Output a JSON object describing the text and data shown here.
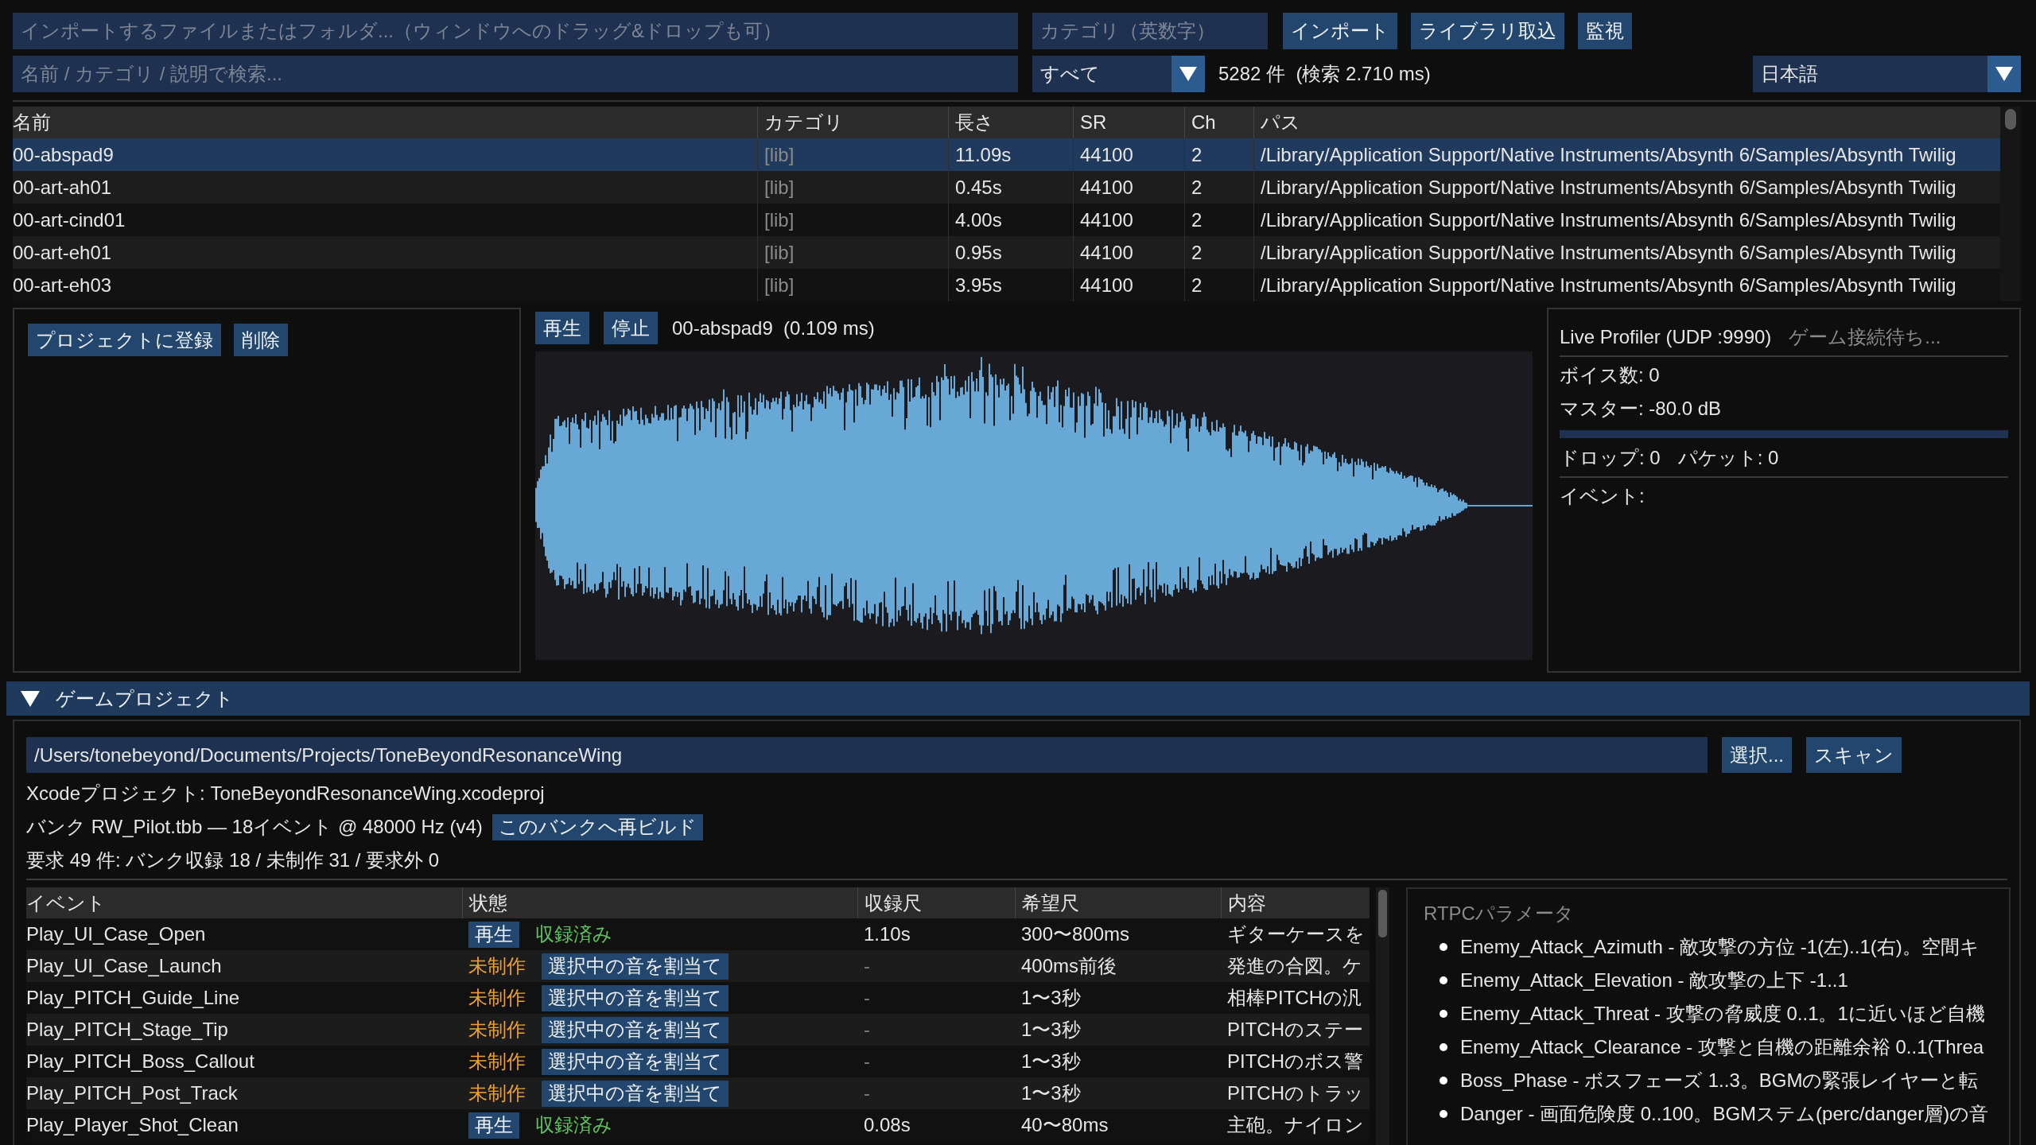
{
  "toolbar": {
    "import_field": {
      "placeholder": "インポートするファイルまたはフォルダ...（ウィンドウへのドラッグ&ドロップも可）"
    },
    "category_field": {
      "placeholder": "カテゴリ（英数字）"
    },
    "buttons": [
      "インポート",
      "ライブラリ取込",
      "監視"
    ],
    "search_field": {
      "placeholder": "名前 / カテゴリ / 説明で検索..."
    },
    "filter_dropdown": {
      "value": "すべて"
    },
    "result_count": "5282 件  (検索 2.710 ms)",
    "language_dropdown": {
      "value": "日本語"
    }
  },
  "library_table": {
    "columns": [
      "名前",
      "カテゴリ",
      "長さ",
      "SR",
      "Ch",
      "パス"
    ],
    "rows": [
      {
        "cells": [
          "00-abspad9",
          "[lib]",
          "11.09s",
          "44100",
          "2",
          "/Library/Application Support/Native Instruments/Absynth 6/Samples/Absynth Twilig"
        ],
        "selected": true
      },
      {
        "cells": [
          "00-art-ah01",
          "[lib]",
          "0.45s",
          "44100",
          "2",
          "/Library/Application Support/Native Instruments/Absynth 6/Samples/Absynth Twilig"
        ],
        "selected": false
      },
      {
        "cells": [
          "00-art-cind01",
          "[lib]",
          "4.00s",
          "44100",
          "2",
          "/Library/Application Support/Native Instruments/Absynth 6/Samples/Absynth Twilig"
        ],
        "selected": false
      },
      {
        "cells": [
          "00-art-eh01",
          "[lib]",
          "0.95s",
          "44100",
          "2",
          "/Library/Application Support/Native Instruments/Absynth 6/Samples/Absynth Twilig"
        ],
        "selected": false
      },
      {
        "cells": [
          "00-art-eh03",
          "[lib]",
          "3.95s",
          "44100",
          "2",
          "/Library/Application Support/Native Instruments/Absynth 6/Samples/Absynth Twilig"
        ],
        "selected": false
      }
    ]
  },
  "preview": {
    "side_buttons": [
      "プロジェクトに登録",
      "削除"
    ],
    "player_buttons": [
      "再生",
      "停止"
    ],
    "now_playing": "00-abspad9  (0.109 ms)"
  },
  "profiler": {
    "title": "Live Profiler (UDP :9990)",
    "status": "ゲーム接続待ち...",
    "voices": "ボイス数: 0",
    "master": "マスター: -80.0 dB",
    "master_meter": {
      "level": 0
    },
    "drops": "ドロップ: 0",
    "packets": "パケット: 0",
    "events_label": "イベント:"
  },
  "game_project": {
    "title": "ゲームプロジェクト",
    "expanded": true,
    "path_field": {
      "value": "/Users/tonebeyond/Documents/Projects/ToneBeyondResonanceWing"
    },
    "buttons": [
      "選択...",
      "スキャン"
    ],
    "xcode_info": "Xcodeプロジェクト: ToneBeyondResonanceWing.xcodeproj",
    "bank_info": "バンク RW_Pilot.tbb — 18イベント @ 48000 Hz (v4)",
    "rebuild_button": "このバンクへ再ビルド",
    "summary": "要求 49 件: バンク収録 18 / 未制作 31 / 要求外 0",
    "events_table": {
      "columns": [
        "イベント",
        "状態",
        "収録尺",
        "希望尺",
        "内容"
      ],
      "rows": [
        {
          "event": "Play_UI_Case_Open",
          "kind": "recorded",
          "button": "再生",
          "status": "収録済み",
          "length": "1.10s",
          "target": "300〜800ms",
          "content": "ギターケースを"
        },
        {
          "event": "Play_UI_Case_Launch",
          "kind": "missing",
          "button": "選択中の音を割当て",
          "status": "未制作",
          "length": "-",
          "target": "400ms前後",
          "content": "発進の合図。ケ"
        },
        {
          "event": "Play_PITCH_Guide_Line",
          "kind": "missing",
          "button": "選択中の音を割当て",
          "status": "未制作",
          "length": "-",
          "target": "1〜3秒",
          "content": "相棒PITCHの汎"
        },
        {
          "event": "Play_PITCH_Stage_Tip",
          "kind": "missing",
          "button": "選択中の音を割当て",
          "status": "未制作",
          "length": "-",
          "target": "1〜3秒",
          "content": "PITCHのステー"
        },
        {
          "event": "Play_PITCH_Boss_Callout",
          "kind": "missing",
          "button": "選択中の音を割当て",
          "status": "未制作",
          "length": "-",
          "target": "1〜3秒",
          "content": "PITCHのボス警"
        },
        {
          "event": "Play_PITCH_Post_Track",
          "kind": "missing",
          "button": "選択中の音を割当て",
          "status": "未制作",
          "length": "-",
          "target": "1〜3秒",
          "content": "PITCHのトラッ"
        },
        {
          "event": "Play_Player_Shot_Clean",
          "kind": "recorded",
          "button": "再生",
          "status": "収録済み",
          "length": "0.08s",
          "target": "40〜80ms",
          "content": "主砲。ナイロン"
        }
      ]
    },
    "rtpc": {
      "title": "RTPCパラメータ",
      "items": [
        "Enemy_Attack_Azimuth - 敵攻撃の方位 -1(左)..1(右)。空間キ",
        "Enemy_Attack_Elevation - 敵攻撃の上下 -1..1",
        "Enemy_Attack_Threat - 攻撃の脅威度 0..1。1に近いほど自機",
        "Enemy_Attack_Clearance - 攻撃と自機の距離余裕 0..1(Threa",
        "Boss_Phase - ボスフェーズ 1..3。BGMの緊張レイヤーと転",
        "Danger - 画面危険度 0..100。BGMステム(perc/danger層)の音"
      ]
    }
  }
}
